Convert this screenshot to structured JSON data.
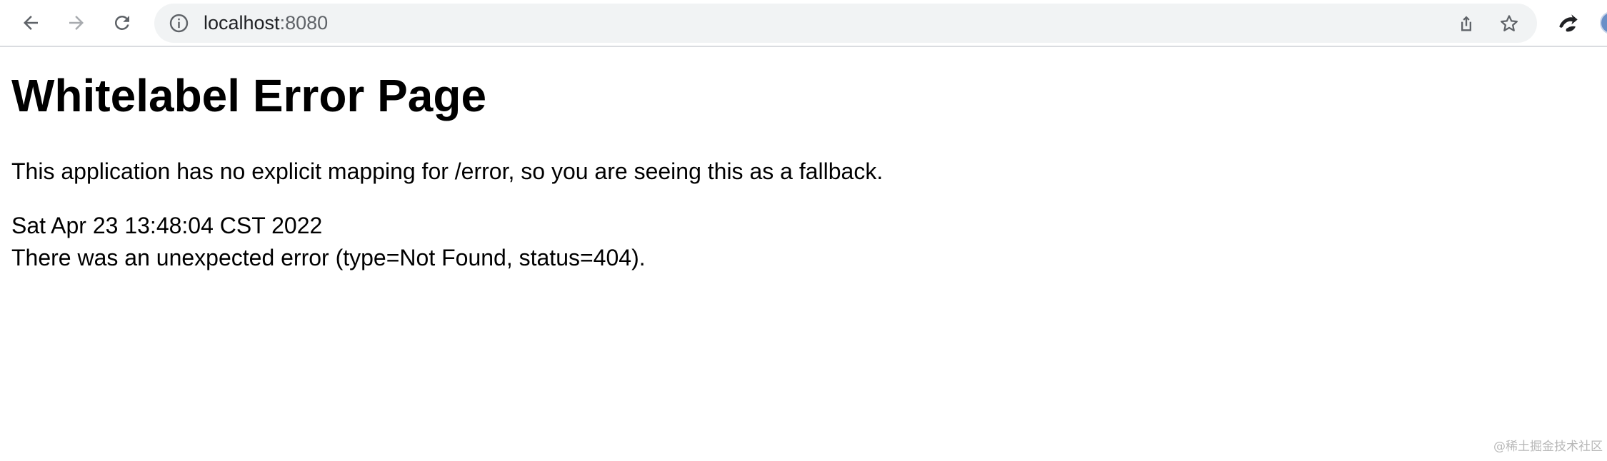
{
  "browser": {
    "url_host": "localhost",
    "url_port": ":8080",
    "icons": {
      "back": "arrow-left-icon",
      "forward": "arrow-right-icon",
      "reload": "reload-icon",
      "site_info": "info-circle-icon",
      "share": "share-icon",
      "bookmark": "star-icon",
      "extension": "extension-icon"
    },
    "colors": {
      "toolbar_bg": "#ffffff",
      "omnibox_bg": "#f1f3f4",
      "icon_active": "#5f6368",
      "icon_disabled": "#a8abaf"
    }
  },
  "page": {
    "heading": "Whitelabel Error Page",
    "message": "This application has no explicit mapping for /error, so you are seeing this as a fallback.",
    "timestamp": "Sat Apr 23 13:48:04 CST 2022",
    "error_detail": "There was an unexpected error (type=Not Found, status=404)."
  },
  "watermark": "@稀土掘金技术社区"
}
